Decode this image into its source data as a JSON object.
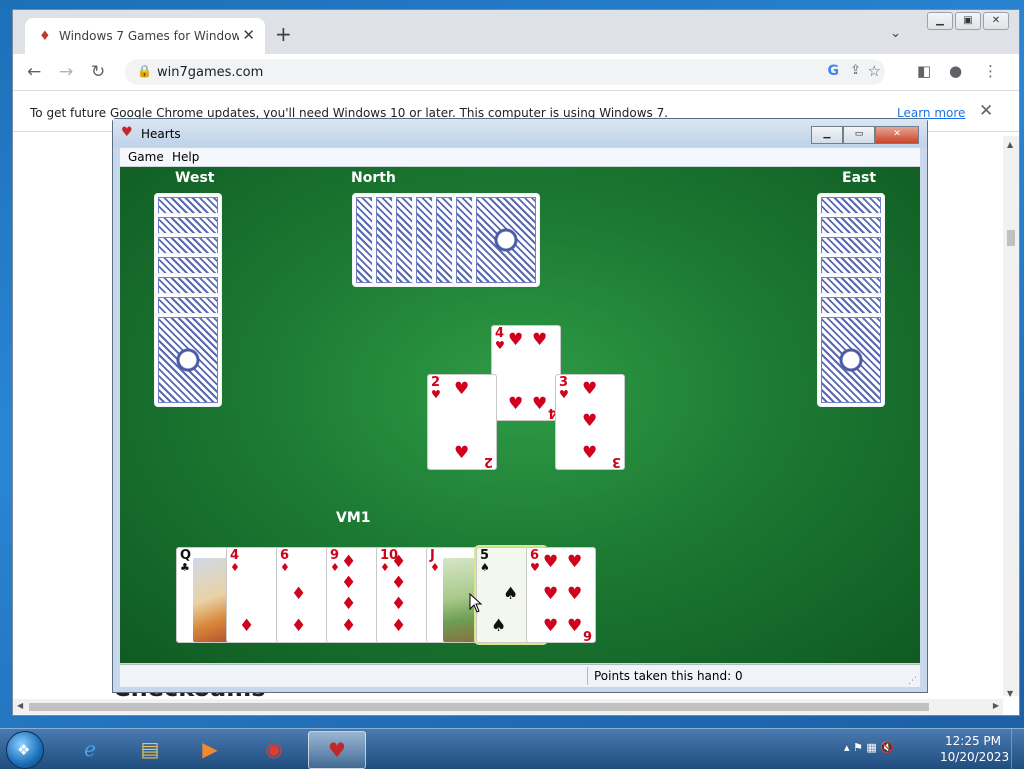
{
  "browser": {
    "tab_title": "Windows 7 Games for Windows",
    "tab_close": "✕",
    "new_tab": "+",
    "url": "win7games.com",
    "infobar_message": "To get future Google Chrome updates, you'll need Windows 10 or later. This computer is using Windows 7.",
    "infobar_link": "Learn more",
    "page_text_behind": "Checkoams"
  },
  "hearts": {
    "title": "Hearts",
    "menu": [
      "Game",
      "Help"
    ],
    "players": {
      "west": "West",
      "north": "North",
      "east": "East",
      "south": "VM1"
    },
    "status": "Points taken this hand: 0",
    "trick": [
      {
        "rank": "2",
        "suit": "♥"
      },
      {
        "rank": "4",
        "suit": "♥"
      },
      {
        "rank": "3",
        "suit": "♥"
      }
    ],
    "hand": [
      {
        "rank": "Q",
        "suit": "♣"
      },
      {
        "rank": "4",
        "suit": "♦"
      },
      {
        "rank": "6",
        "suit": "♦"
      },
      {
        "rank": "9",
        "suit": "♦"
      },
      {
        "rank": "10",
        "suit": "♦"
      },
      {
        "rank": "J",
        "suit": "♦"
      },
      {
        "rank": "5",
        "suit": "♠"
      },
      {
        "rank": "6",
        "suit": "♥"
      }
    ]
  },
  "taskbar": {
    "time": "12:25 PM",
    "date": "10/20/2023"
  },
  "colors": {
    "felt": "#1d7a33",
    "card_red": "#d0021b",
    "card_back": "#5868b3"
  }
}
